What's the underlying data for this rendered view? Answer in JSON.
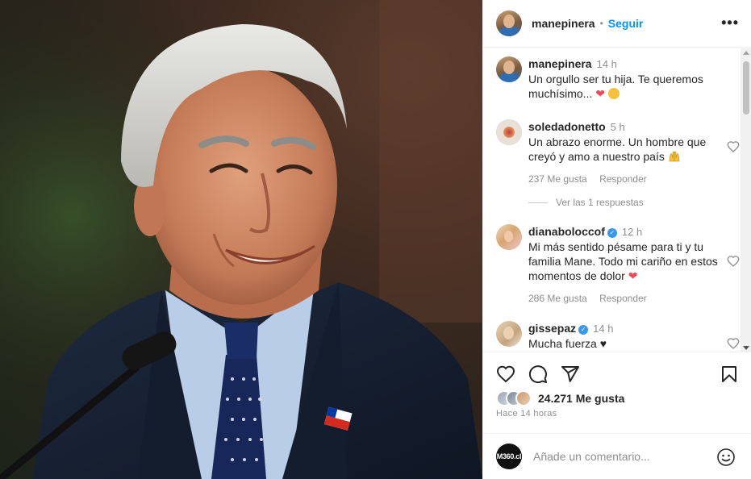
{
  "post": {
    "owner_username": "manepinera",
    "follow_label": "Seguir",
    "separator": "•",
    "more_label": "•••"
  },
  "caption": {
    "username": "manepinera",
    "time": "14 h",
    "text": "Un orgullo ser tu hija. Te queremos muchísimo..."
  },
  "comments": [
    {
      "username": "soledadonetto",
      "time": "5 h",
      "text": "Un abrazo enorme. Un hombre que creyó y amo a nuestro país",
      "likes": "237 Me gusta",
      "reply_label": "Responder"
    },
    {
      "username": "dianaboloccof",
      "verified": true,
      "time": "12 h",
      "text": "Mi más sentido pésame para ti y tu familia Mane. Todo mi cariño en estos momentos de dolor",
      "likes": "286 Me gusta",
      "reply_label": "Responder"
    },
    {
      "username": "gissepaz",
      "verified": true,
      "time": "14 h",
      "text": "Mucha fuerza"
    }
  ],
  "view_replies": "Ver las 1 respuestas",
  "likes_total": "24.271 Me gusta",
  "post_time": "Hace 14 horas",
  "add_comment": {
    "avatar_text": "M360.cl",
    "placeholder": "Añade un comentario..."
  },
  "colors": {
    "accent": "#0095f6",
    "heart": "#ed4956",
    "verified": "#3897f0",
    "text": "#262626",
    "muted": "#8e8e8e"
  },
  "icons": [
    "more-options-icon",
    "heart-icon",
    "comment-icon",
    "share-icon",
    "bookmark-icon",
    "emoji-icon",
    "verified-badge-icon"
  ]
}
